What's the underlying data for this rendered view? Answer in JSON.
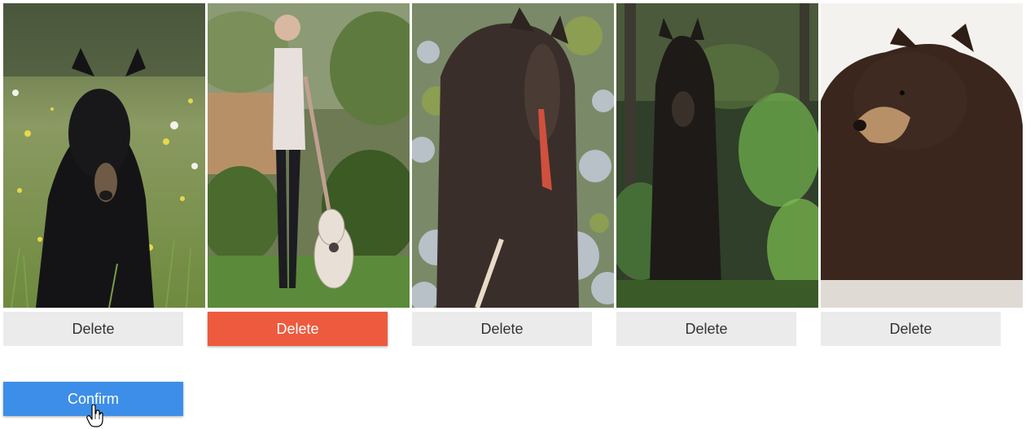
{
  "images": [
    {
      "icon": "black-bear-in-meadow-image",
      "delete_label": "Delete",
      "selected": false
    },
    {
      "icon": "person-with-guitar-image",
      "delete_label": "Delete",
      "selected": true
    },
    {
      "icon": "brown-bear-on-rocks-image",
      "delete_label": "Delete",
      "selected": false
    },
    {
      "icon": "black-bear-in-forest-image",
      "delete_label": "Delete",
      "selected": false
    },
    {
      "icon": "brown-bear-portrait-image",
      "delete_label": "Delete",
      "selected": false
    }
  ],
  "confirm_label": "Confirm",
  "colors": {
    "delete_default_bg": "#ebebeb",
    "delete_selected_bg": "#ee5a3e",
    "confirm_bg": "#3d8ee8"
  }
}
